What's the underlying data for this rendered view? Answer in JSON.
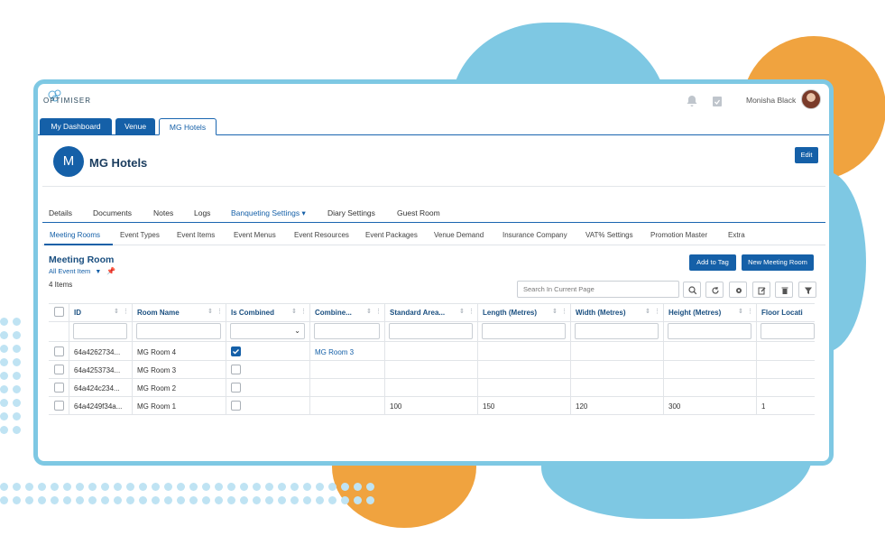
{
  "app": {
    "logo_text": "OPTIMISER",
    "user_name": "Monisha Black"
  },
  "main_tabs": [
    {
      "label": "My Dashboard"
    },
    {
      "label": "Venue"
    },
    {
      "label": "MG Hotels"
    }
  ],
  "header": {
    "initial": "M",
    "title": "MG Hotels",
    "edit_label": "Edit"
  },
  "nav_primary": [
    {
      "label": "Details"
    },
    {
      "label": "Documents"
    },
    {
      "label": "Notes"
    },
    {
      "label": "Logs"
    },
    {
      "label": "Banqueting Settings ▾"
    },
    {
      "label": "Diary Settings"
    },
    {
      "label": "Guest Room"
    }
  ],
  "nav_secondary": [
    {
      "label": "Meeting Rooms"
    },
    {
      "label": "Event Types"
    },
    {
      "label": "Event Items"
    },
    {
      "label": "Event Menus"
    },
    {
      "label": "Event Resources"
    },
    {
      "label": "Event Packages"
    },
    {
      "label": "Venue Demand"
    },
    {
      "label": "Insurance Company"
    },
    {
      "label": "VAT% Settings"
    },
    {
      "label": "Promotion Master"
    },
    {
      "label": "Extra"
    }
  ],
  "section": {
    "title": "Meeting Room",
    "subtitle": "All Event Item",
    "count": "4 Items",
    "add_to_tag": "Add to Tag",
    "new_meeting_room": "New Meeting Room",
    "search_placeholder": "Search In Current Page"
  },
  "grid": {
    "columns": [
      "ID",
      "Room Name",
      "Is Combined",
      "Combine...",
      "Standard Area...",
      "Length (Metres)",
      "Width (Metres)",
      "Height (Metres)",
      "Floor Location"
    ],
    "rows": [
      {
        "id": "64a4262734...",
        "room_name": "MG Room 4",
        "is_combined": true,
        "combine": "MG Room 3",
        "area": "",
        "length": "",
        "width": "",
        "height": "",
        "floor": ""
      },
      {
        "id": "64a4253734...",
        "room_name": "MG Room 3",
        "is_combined": false,
        "combine": "",
        "area": "",
        "length": "",
        "width": "",
        "height": "",
        "floor": ""
      },
      {
        "id": "64a424c234...",
        "room_name": "MG Room 2",
        "is_combined": false,
        "combine": "",
        "area": "",
        "length": "",
        "width": "",
        "height": "",
        "floor": ""
      },
      {
        "id": "64a4249f34a...",
        "room_name": "MG Room 1",
        "is_combined": false,
        "combine": "",
        "area": "100",
        "length": "150",
        "width": "120",
        "height": "300",
        "floor": "1"
      }
    ]
  },
  "colors": {
    "primary": "#1560a8",
    "accent_orange": "#f0a33f",
    "accent_blue": "#7ec8e3"
  }
}
